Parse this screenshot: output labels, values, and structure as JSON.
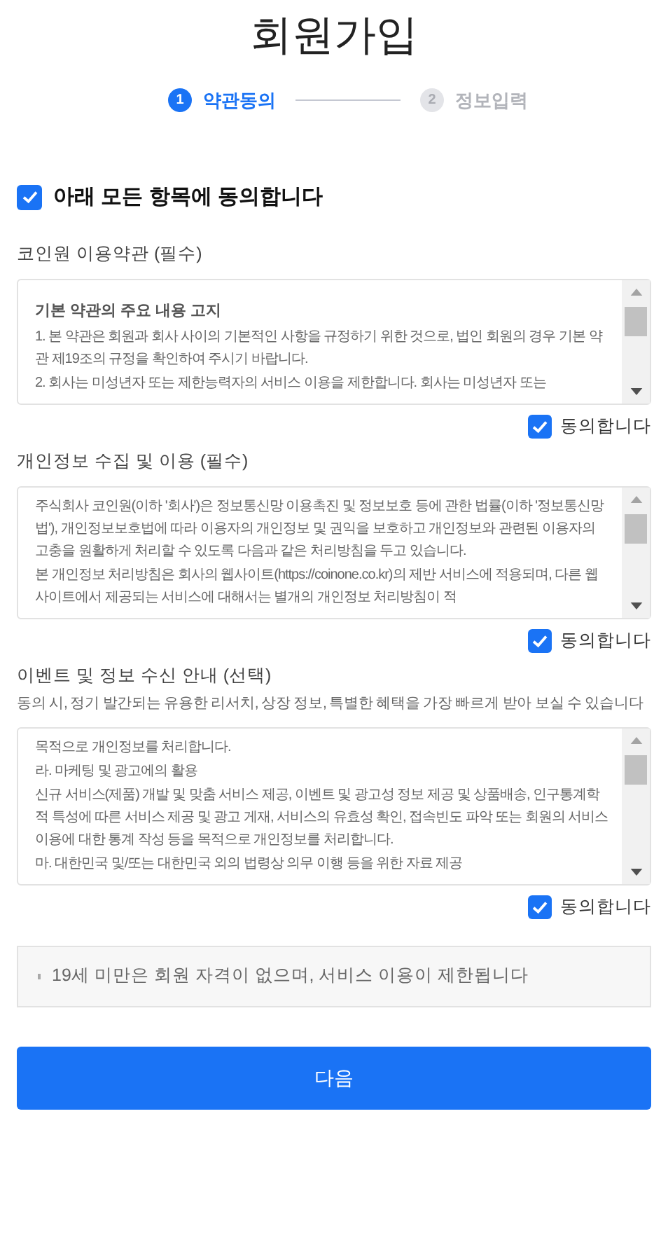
{
  "title": "회원가입",
  "steps": [
    {
      "number": "1",
      "label": "약관동의",
      "selected": true
    },
    {
      "number": "2",
      "label": "정보입력",
      "selected": false
    }
  ],
  "agree_all": {
    "label": "아래 모든 항목에 동의합니다",
    "checked": true
  },
  "sections": [
    {
      "title": "코인원 이용약관 (필수)",
      "paragraphs": [
        {
          "kind": "heading",
          "text": "기본 약관의 주요 내용 고지"
        },
        {
          "kind": "text",
          "text": "1. 본 약관은 회원과 회사 사이의 기본적인 사항을 규정하기 위한 것으로, 법인 회원의 경우 기본 약관 제19조의 규정을 확인하여 주시기 바랍니다."
        },
        {
          "kind": "text",
          "text": "2. 회사는 미성년자 또는 제한능력자의 서비스 이용을 제한합니다. 회사는 미성년자 또는"
        }
      ],
      "agree": {
        "label": "동의합니다",
        "checked": true
      }
    },
    {
      "title": "개인정보 수집 및 이용 (필수)",
      "paragraphs": [
        {
          "kind": "text",
          "text": "주식회사 코인원(이하 '회사')은 정보통신망 이용촉진 및 정보보호 등에 관한 법률(이하 '정보통신망법'), 개인정보보호법에 따라 이용자의 개인정보 및 권익을 보호하고 개인정보와 관련된 이용자의 고충을 원활하게 처리할 수 있도록 다음과 같은 처리방침을 두고 있습니다."
        },
        {
          "kind": "text",
          "text": "본 개인정보 처리방침은 회사의 웹사이트(https://coinone.co.kr)의 제반 서비스에 적용되며, 다른 웹사이트에서 제공되는 서비스에 대해서는 별개의 개인정보 처리방침이 적"
        }
      ],
      "agree": {
        "label": "동의합니다",
        "checked": true
      }
    },
    {
      "title": "이벤트 및 정보 수신 안내 (선택)",
      "description": "동의 시, 정기 발간되는 유용한 리서치, 상장 정보, 특별한 혜택을 가장 빠르게 받아 보실 수 있습니다",
      "paragraphs": [
        {
          "kind": "text",
          "text": "목적으로 개인정보를 처리합니다."
        },
        {
          "kind": "text",
          "text": "라. 마케팅 및 광고에의 활용"
        },
        {
          "kind": "text",
          "text": "신규 서비스(제품) 개발 및 맞춤 서비스 제공, 이벤트 및 광고성 정보 제공 및 상품배송, 인구통계학적 특성에 따른 서비스 제공 및 광고 게재, 서비스의 유효성 확인, 접속빈도 파악 또는 회원의 서비스 이용에 대한 통계 작성 등을 목적으로 개인정보를 처리합니다."
        },
        {
          "kind": "text",
          "text": "마. 대한민국 및/또는 대한민국 외의 법령상 의무 이행 등을 위한 자료 제공"
        }
      ],
      "agree": {
        "label": "동의합니다",
        "checked": true
      }
    }
  ],
  "notice": "19세 미만은 회원 자격이 없으며, 서비스 이용이 제한됩니다",
  "next_button": "다음"
}
